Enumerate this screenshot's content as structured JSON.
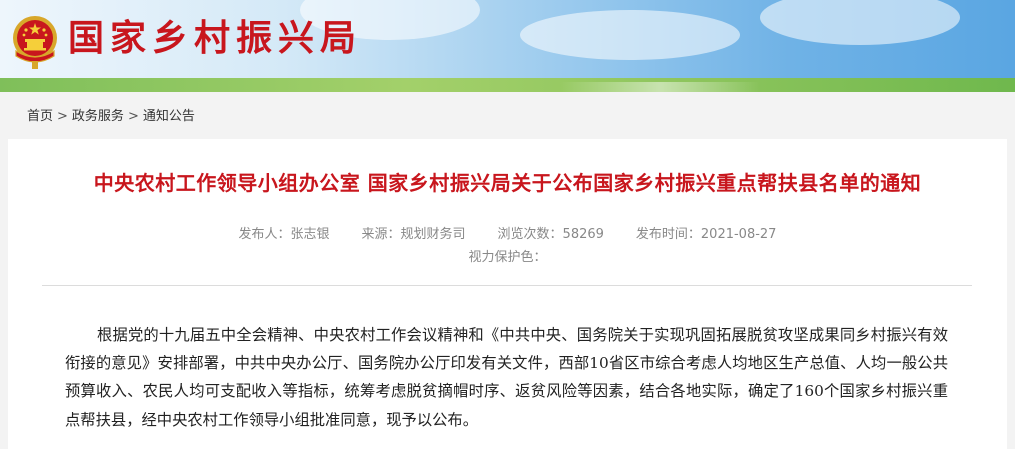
{
  "header": {
    "site_title": "国家乡村振兴局",
    "emblem_icon": "national-emblem-icon"
  },
  "breadcrumb": {
    "items": [
      "首页",
      "政务服务",
      "通知公告"
    ],
    "separator": ">"
  },
  "article": {
    "title": "中央农村工作领导小组办公室 国家乡村振兴局关于公布国家乡村振兴重点帮扶县名单的通知",
    "meta": {
      "publisher": "发布人：张志银",
      "source": "来源：规划财务司",
      "views": "浏览次数：58269",
      "date": "发布时间：2021-08-27",
      "vision": "视力保护色："
    },
    "body": "根据党的十九届五中全会精神、中央农村工作会议精神和《中共中央、国务院关于实现巩固拓展脱贫攻坚成果同乡村振兴有效衔接的意见》安排部署，中共中央办公厅、国务院办公厅印发有关文件，西部10省区市综合考虑人均地区生产总值、人均一般公共预算收入、农民人均可支配收入等指标，统筹考虑脱贫摘帽时序、返贫风险等因素，结合各地实际，确定了160个国家乡村振兴重点帮扶县，经中央农村工作领导小组批准同意，现予以公布。"
  },
  "colors": {
    "brand_red": "#c8161d",
    "meta_gray": "#888888",
    "page_bg": "#f3f3f3"
  }
}
